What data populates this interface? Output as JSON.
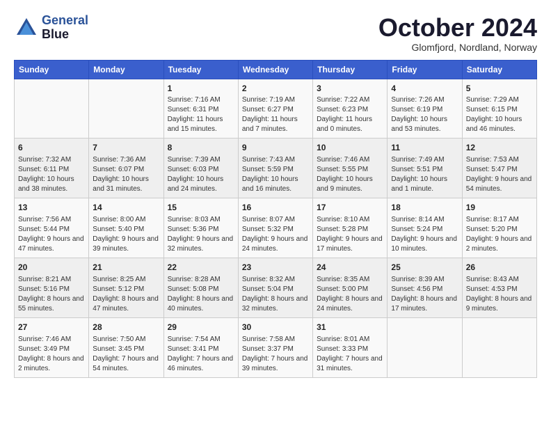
{
  "header": {
    "logo_line1": "General",
    "logo_line2": "Blue",
    "month": "October 2024",
    "location": "Glomfjord, Nordland, Norway"
  },
  "days_of_week": [
    "Sunday",
    "Monday",
    "Tuesday",
    "Wednesday",
    "Thursday",
    "Friday",
    "Saturday"
  ],
  "weeks": [
    [
      {
        "day": "",
        "content": ""
      },
      {
        "day": "",
        "content": ""
      },
      {
        "day": "1",
        "content": "Sunrise: 7:16 AM\nSunset: 6:31 PM\nDaylight: 11 hours and 15 minutes."
      },
      {
        "day": "2",
        "content": "Sunrise: 7:19 AM\nSunset: 6:27 PM\nDaylight: 11 hours and 7 minutes."
      },
      {
        "day": "3",
        "content": "Sunrise: 7:22 AM\nSunset: 6:23 PM\nDaylight: 11 hours and 0 minutes."
      },
      {
        "day": "4",
        "content": "Sunrise: 7:26 AM\nSunset: 6:19 PM\nDaylight: 10 hours and 53 minutes."
      },
      {
        "day": "5",
        "content": "Sunrise: 7:29 AM\nSunset: 6:15 PM\nDaylight: 10 hours and 46 minutes."
      }
    ],
    [
      {
        "day": "6",
        "content": "Sunrise: 7:32 AM\nSunset: 6:11 PM\nDaylight: 10 hours and 38 minutes."
      },
      {
        "day": "7",
        "content": "Sunrise: 7:36 AM\nSunset: 6:07 PM\nDaylight: 10 hours and 31 minutes."
      },
      {
        "day": "8",
        "content": "Sunrise: 7:39 AM\nSunset: 6:03 PM\nDaylight: 10 hours and 24 minutes."
      },
      {
        "day": "9",
        "content": "Sunrise: 7:43 AM\nSunset: 5:59 PM\nDaylight: 10 hours and 16 minutes."
      },
      {
        "day": "10",
        "content": "Sunrise: 7:46 AM\nSunset: 5:55 PM\nDaylight: 10 hours and 9 minutes."
      },
      {
        "day": "11",
        "content": "Sunrise: 7:49 AM\nSunset: 5:51 PM\nDaylight: 10 hours and 1 minute."
      },
      {
        "day": "12",
        "content": "Sunrise: 7:53 AM\nSunset: 5:47 PM\nDaylight: 9 hours and 54 minutes."
      }
    ],
    [
      {
        "day": "13",
        "content": "Sunrise: 7:56 AM\nSunset: 5:44 PM\nDaylight: 9 hours and 47 minutes."
      },
      {
        "day": "14",
        "content": "Sunrise: 8:00 AM\nSunset: 5:40 PM\nDaylight: 9 hours and 39 minutes."
      },
      {
        "day": "15",
        "content": "Sunrise: 8:03 AM\nSunset: 5:36 PM\nDaylight: 9 hours and 32 minutes."
      },
      {
        "day": "16",
        "content": "Sunrise: 8:07 AM\nSunset: 5:32 PM\nDaylight: 9 hours and 24 minutes."
      },
      {
        "day": "17",
        "content": "Sunrise: 8:10 AM\nSunset: 5:28 PM\nDaylight: 9 hours and 17 minutes."
      },
      {
        "day": "18",
        "content": "Sunrise: 8:14 AM\nSunset: 5:24 PM\nDaylight: 9 hours and 10 minutes."
      },
      {
        "day": "19",
        "content": "Sunrise: 8:17 AM\nSunset: 5:20 PM\nDaylight: 9 hours and 2 minutes."
      }
    ],
    [
      {
        "day": "20",
        "content": "Sunrise: 8:21 AM\nSunset: 5:16 PM\nDaylight: 8 hours and 55 minutes."
      },
      {
        "day": "21",
        "content": "Sunrise: 8:25 AM\nSunset: 5:12 PM\nDaylight: 8 hours and 47 minutes."
      },
      {
        "day": "22",
        "content": "Sunrise: 8:28 AM\nSunset: 5:08 PM\nDaylight: 8 hours and 40 minutes."
      },
      {
        "day": "23",
        "content": "Sunrise: 8:32 AM\nSunset: 5:04 PM\nDaylight: 8 hours and 32 minutes."
      },
      {
        "day": "24",
        "content": "Sunrise: 8:35 AM\nSunset: 5:00 PM\nDaylight: 8 hours and 24 minutes."
      },
      {
        "day": "25",
        "content": "Sunrise: 8:39 AM\nSunset: 4:56 PM\nDaylight: 8 hours and 17 minutes."
      },
      {
        "day": "26",
        "content": "Sunrise: 8:43 AM\nSunset: 4:53 PM\nDaylight: 8 hours and 9 minutes."
      }
    ],
    [
      {
        "day": "27",
        "content": "Sunrise: 7:46 AM\nSunset: 3:49 PM\nDaylight: 8 hours and 2 minutes."
      },
      {
        "day": "28",
        "content": "Sunrise: 7:50 AM\nSunset: 3:45 PM\nDaylight: 7 hours and 54 minutes."
      },
      {
        "day": "29",
        "content": "Sunrise: 7:54 AM\nSunset: 3:41 PM\nDaylight: 7 hours and 46 minutes."
      },
      {
        "day": "30",
        "content": "Sunrise: 7:58 AM\nSunset: 3:37 PM\nDaylight: 7 hours and 39 minutes."
      },
      {
        "day": "31",
        "content": "Sunrise: 8:01 AM\nSunset: 3:33 PM\nDaylight: 7 hours and 31 minutes."
      },
      {
        "day": "",
        "content": ""
      },
      {
        "day": "",
        "content": ""
      }
    ]
  ]
}
